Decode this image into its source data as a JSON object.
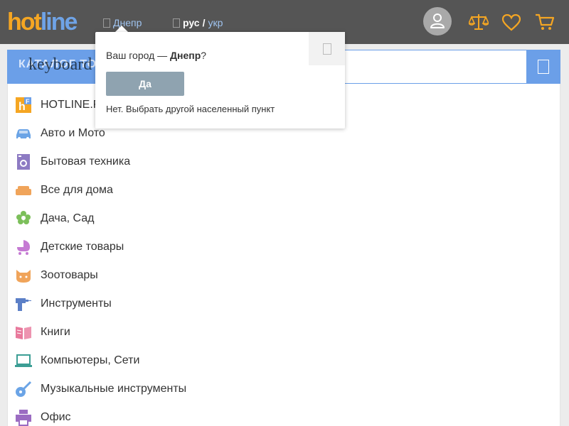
{
  "header": {
    "logo_hot": "hot",
    "logo_line": "line",
    "city": "Днепр",
    "lang_ru": "рус",
    "lang_sep": "/",
    "lang_uk": "укр",
    "icons": [
      "user-icon",
      "scales-icon",
      "heart-icon",
      "cart-icon"
    ]
  },
  "catalog": {
    "title": "КАТАЛОГ ТОВАРОВ",
    "overlay_text": "keyboard"
  },
  "search": {
    "placeholder": ""
  },
  "categories": [
    {
      "label": "HOTLINE.F",
      "icon": "hotline-finance-icon",
      "color": "#f5a623"
    },
    {
      "label": "Авто и Мото",
      "icon": "car-icon",
      "color": "#6ba4e6"
    },
    {
      "label": "Бытовая техника",
      "icon": "washing-machine-icon",
      "color": "#8d7bc3"
    },
    {
      "label": "Все для дома",
      "icon": "sofa-icon",
      "color": "#f0a45a"
    },
    {
      "label": "Дача, Сад",
      "icon": "flower-icon",
      "color": "#7cbf5a"
    },
    {
      "label": "Детские товары",
      "icon": "stroller-icon",
      "color": "#c57ad3"
    },
    {
      "label": "Зоотовары",
      "icon": "cat-icon",
      "color": "#f0a45a"
    },
    {
      "label": "Инструменты",
      "icon": "drill-icon",
      "color": "#5b7fc7"
    },
    {
      "label": "Книги",
      "icon": "book-icon",
      "color": "#e8799c"
    },
    {
      "label": "Компьютеры, Сети",
      "icon": "laptop-icon",
      "color": "#3c9e95"
    },
    {
      "label": "Музыкальные инструменты",
      "icon": "guitar-icon",
      "color": "#6ba4e6"
    },
    {
      "label": "Офис",
      "icon": "printer-icon",
      "color": "#9b6cc2"
    }
  ],
  "city_popup": {
    "question_prefix": "Ваш город — ",
    "city": "Днепр",
    "question_suffix": "?",
    "yes_label": "Да",
    "no_label": "Нет. Выбрать другой населенный пункт"
  },
  "colors": {
    "header_bg": "#555555",
    "accent_blue": "#6b9fe8",
    "accent_orange": "#f5a623"
  }
}
